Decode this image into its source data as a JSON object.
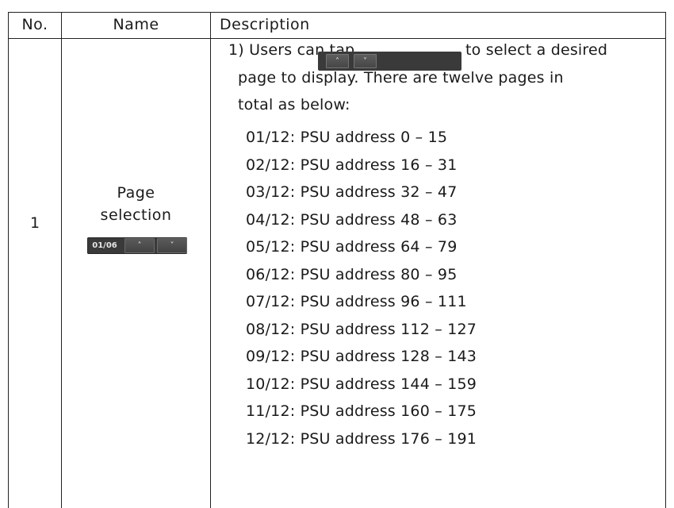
{
  "table": {
    "headers": {
      "no": "No.",
      "name": "Name",
      "description": "Description"
    },
    "rows": [
      {
        "no": "1",
        "name_line1": "Page",
        "name_line2": "selection",
        "pager": {
          "label": "01/06",
          "up_icon": "chevron-up-icon",
          "down_icon": "chevron-down-icon"
        },
        "description": {
          "intro_part1": "1) Users can tap",
          "intro_part2": "to select a desired",
          "intro_line2": "page to display. There are twelve pages in",
          "intro_line3": "total as below:",
          "pages": [
            "01/12: PSU address 0 – 15",
            "02/12: PSU address 16 – 31",
            "03/12: PSU address 32 – 47",
            "04/12: PSU address 48 – 63",
            "05/12: PSU address 64 – 79",
            "06/12: PSU address 80 – 95",
            "07/12: PSU address 96 – 111",
            "08/12: PSU address 112 – 127",
            "09/12: PSU address 128 – 143",
            "10/12: PSU address 144 – 159",
            "11/12: PSU address 160 – 175",
            "12/12: PSU address 176 – 191"
          ]
        }
      }
    ]
  },
  "colors": {
    "widget_bg": "#3a3a3a",
    "widget_text": "#e6e6e6",
    "border": "#222222"
  }
}
